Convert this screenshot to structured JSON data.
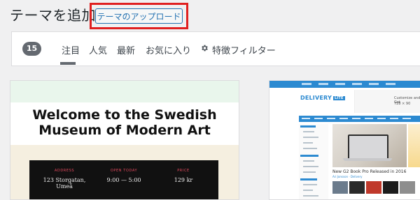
{
  "header": {
    "title": "テーマを追加",
    "upload_button": "テーマのアップロード"
  },
  "filter_bar": {
    "count": "15",
    "tabs": [
      {
        "label": "注目",
        "active": true
      },
      {
        "label": "人気",
        "active": false
      },
      {
        "label": "最新",
        "active": false
      },
      {
        "label": "お気に入り",
        "active": false
      }
    ],
    "feature_filter": "特徴フィルター",
    "feature_filter_icon": "gear-icon"
  },
  "themes": [
    {
      "headline": "Welcome to the Swedish Museum of Modern Art",
      "info": [
        {
          "label": "ADDRESS",
          "value": "123 Storgatan, Umeå"
        },
        {
          "label": "OPEN TODAY",
          "value": "9:00 — 5:00"
        },
        {
          "label": "PRICE",
          "value": "129 kr"
        }
      ]
    },
    {
      "logo": "DELIVERY",
      "logo_badge": "LITE",
      "ad_line1": "Customize and Get",
      "ad_line2": "728 × 90",
      "post_title": "New G2 Book Pro Released in 2016",
      "post_meta": "Ari Jonsson · Delivery"
    }
  ],
  "colors": {
    "accent_blue": "#2271b1",
    "highlight_red": "#e02020",
    "badge_gray": "#646970"
  }
}
